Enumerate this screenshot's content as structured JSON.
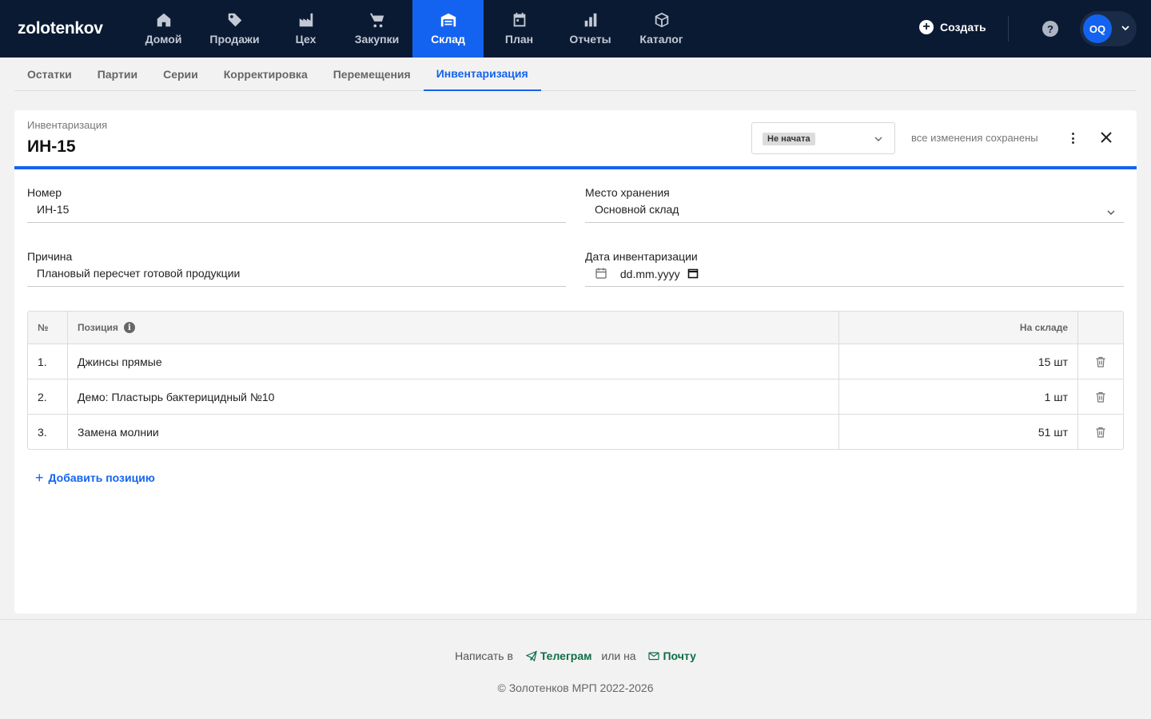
{
  "brand": {
    "logo": "zolotenkov"
  },
  "nav": [
    {
      "label": "Домой",
      "icon": "home-icon"
    },
    {
      "label": "Продажи",
      "icon": "tag-icon"
    },
    {
      "label": "Цех",
      "icon": "factory-icon"
    },
    {
      "label": "Закупки",
      "icon": "cart-icon"
    },
    {
      "label": "Склад",
      "icon": "warehouse-icon",
      "active": true
    },
    {
      "label": "План",
      "icon": "calendar-icon"
    },
    {
      "label": "Отчеты",
      "icon": "bar-chart-icon"
    },
    {
      "label": "Каталог",
      "icon": "box-icon"
    }
  ],
  "header": {
    "create_label": "Создать",
    "help_icon": "?",
    "avatar_initials": "OQ"
  },
  "subnav": [
    {
      "label": "Остатки"
    },
    {
      "label": "Партии"
    },
    {
      "label": "Серии"
    },
    {
      "label": "Корректировка"
    },
    {
      "label": "Перемещения"
    },
    {
      "label": "Инвентаризация",
      "active": true
    }
  ],
  "doc": {
    "subtitle": "Инвентаризация",
    "title": "ИН-15",
    "status": "Не начата",
    "saved_text": "все изменения сохранены"
  },
  "form": {
    "number_label": "Номер",
    "number_value": "ИН-15",
    "storage_label": "Место хранения",
    "storage_value": "Основной склад",
    "reason_label": "Причина",
    "reason_value": "Плановый пересчет готовой продукции",
    "date_label": "Дата инвентаризации",
    "date_value": "dd.mm.yyyy"
  },
  "table": {
    "col_no": "№",
    "col_position": "Позиция",
    "col_info_icon": "i",
    "col_stock": "На складе",
    "rows": [
      {
        "no": "1.",
        "position": "Джинсы прямые",
        "stock": "15 шт"
      },
      {
        "no": "2.",
        "position": "Демо: Пластырь бактерицидный №10",
        "stock": "1 шт"
      },
      {
        "no": "3.",
        "position": "Замена молнии",
        "stock": "51 шт"
      }
    ],
    "add_label": "Добавить позицию"
  },
  "footer": {
    "write_text": "Написать в",
    "telegram_label": "Телеграм",
    "or_text": "или на",
    "mail_label": "Почту",
    "copyright": "© Золотенков МРП 2022-2026"
  },
  "colors": {
    "topbar": "#0a1a33",
    "accent": "#1463f0",
    "link_green": "#0f6e47"
  }
}
